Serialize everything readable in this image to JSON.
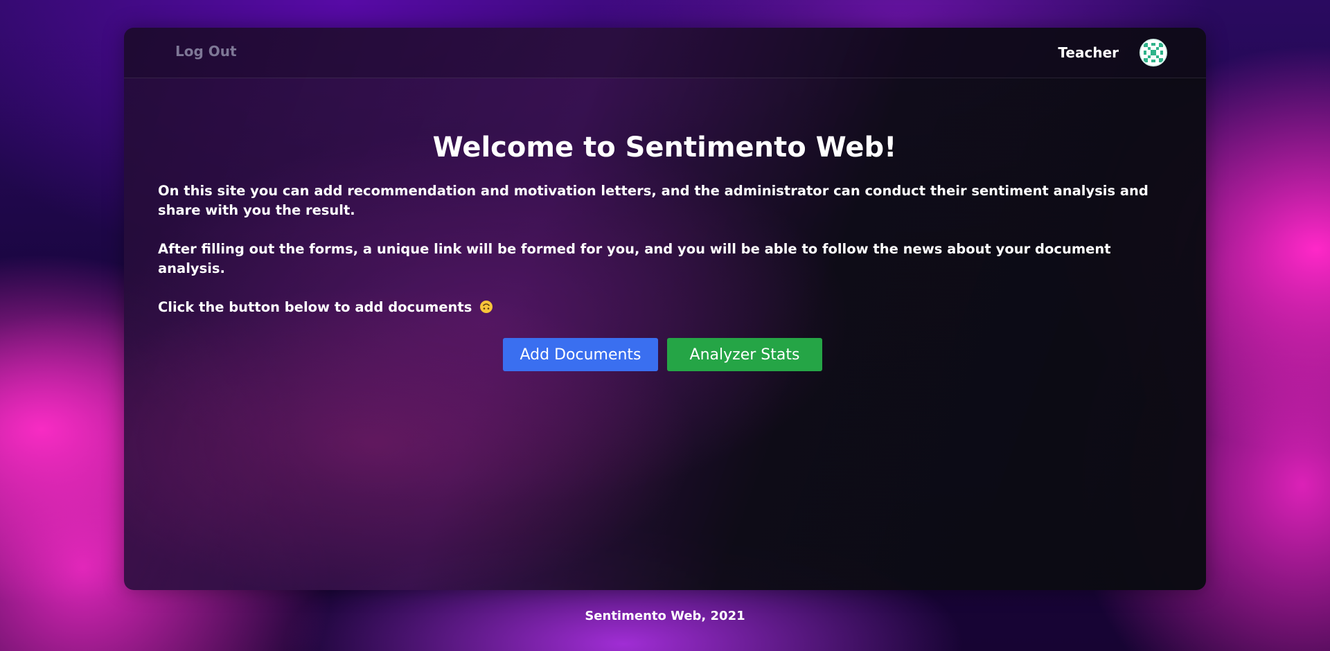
{
  "header": {
    "logout_label": "Log Out",
    "username": "Teacher",
    "avatar_icon": "identicon-avatar-icon"
  },
  "main": {
    "title": "Welcome to Sentimento Web!",
    "paragraph1": "On this site you can add recommendation and motivation letters, and the administrator can conduct their sentiment analysis and share with you the result.",
    "paragraph2": "After filling out the forms, a unique link will be formed for you, and you will be able to follow the news about your document analysis.",
    "paragraph3": "Click the button below to add documents",
    "paragraph3_icon": "upside-down-face-emoji-icon"
  },
  "buttons": {
    "add_documents_label": "Add Documents",
    "analyzer_stats_label": "Analyzer Stats"
  },
  "footer": {
    "text": "Sentimento Web, 2021"
  },
  "colors": {
    "primary_button": "#3a6ff0",
    "success_button": "#25a546",
    "logout_text": "#7e7796"
  }
}
